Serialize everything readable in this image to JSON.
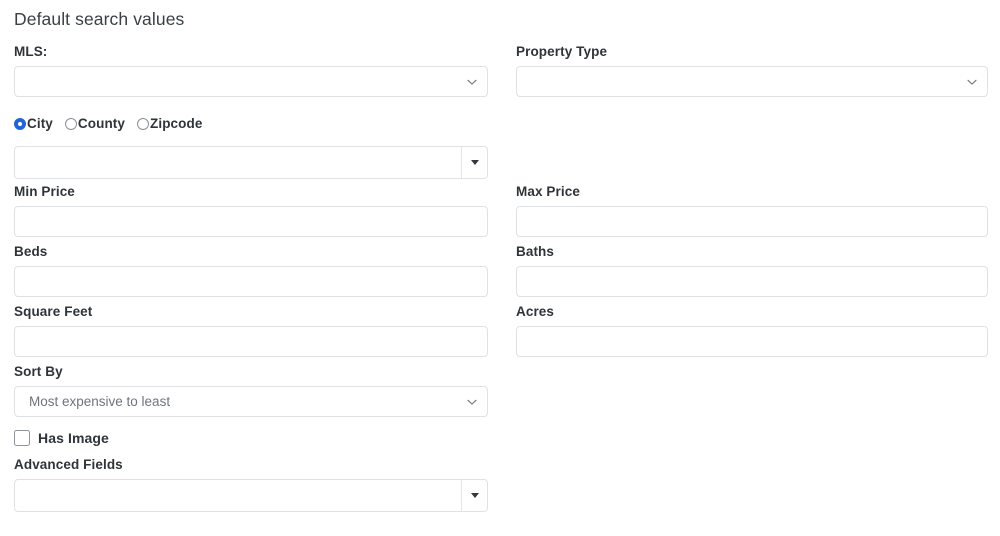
{
  "page": {
    "title": "Default search values",
    "background": "#ffffff",
    "accent_color": "#2265d8",
    "border_color": "#dfe1e5",
    "label_color": "#2f3438"
  },
  "form": {
    "mls": {
      "label": "MLS:",
      "value": "",
      "placeholder": "",
      "icon": "chevron-down-icon"
    },
    "property_type": {
      "label": "Property Type",
      "value": "",
      "placeholder": "",
      "icon": "chevron-down-icon"
    },
    "location_scope": {
      "options": [
        {
          "label": "City",
          "selected": true
        },
        {
          "label": "County",
          "selected": false
        },
        {
          "label": "Zipcode",
          "selected": false
        }
      ]
    },
    "location_combo": {
      "value": "",
      "placeholder": "",
      "icon": "caret-down-icon"
    },
    "min_price": {
      "label": "Min Price",
      "value": "",
      "placeholder": ""
    },
    "max_price": {
      "label": "Max Price",
      "value": "",
      "placeholder": ""
    },
    "beds": {
      "label": "Beds",
      "value": "",
      "placeholder": ""
    },
    "baths": {
      "label": "Baths",
      "value": "",
      "placeholder": ""
    },
    "square_feet": {
      "label": "Square Feet",
      "value": "",
      "placeholder": ""
    },
    "acres": {
      "label": "Acres",
      "value": "",
      "placeholder": ""
    },
    "sort_by": {
      "label": "Sort By",
      "value": "Most expensive to least",
      "icon": "chevron-down-icon"
    },
    "has_image": {
      "label": "Has Image",
      "checked": false
    },
    "advanced_fields": {
      "label": "Advanced Fields",
      "value": "",
      "placeholder": "",
      "icon": "caret-down-icon"
    }
  }
}
